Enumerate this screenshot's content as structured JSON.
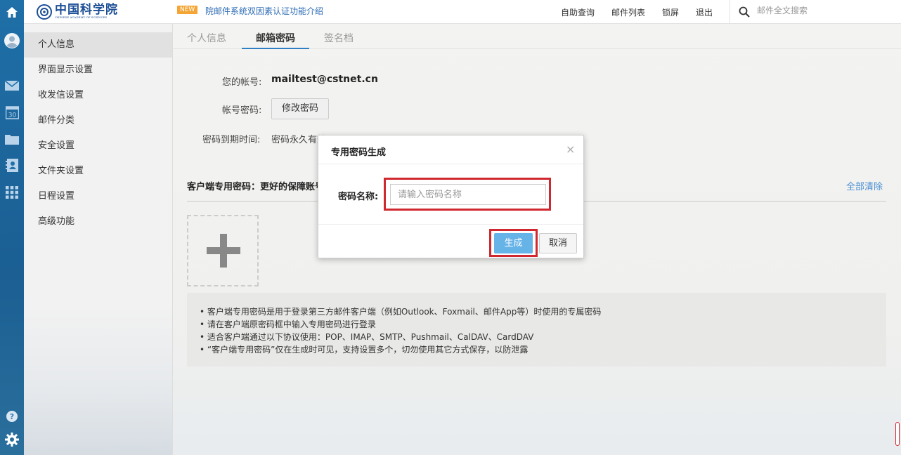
{
  "header": {
    "logo_text": "中国科学院",
    "logo_sub": "CHINESE ACADEMY OF SCIENCES",
    "badge": "NEW",
    "notice": "院邮件系统双因素认证功能介绍",
    "nav": [
      "自助查询",
      "邮件列表",
      "锁屏",
      "退出"
    ],
    "search_placeholder": "邮件全文搜索"
  },
  "rail": {
    "icons": [
      "home-icon",
      "avatar-icon",
      "mail-icon",
      "calendar-icon",
      "folder-icon",
      "contacts-icon",
      "apps-icon",
      "help-icon",
      "settings-icon"
    ],
    "calendar_day": "30"
  },
  "sidebar": {
    "items": [
      "个人信息",
      "界面显示设置",
      "收发信设置",
      "邮件分类",
      "安全设置",
      "文件夹设置",
      "日程设置",
      "高级功能"
    ],
    "active_index": 0
  },
  "tabs": [
    "个人信息",
    "邮箱密码",
    "签名档"
  ],
  "account": {
    "account_label": "您的帐号:",
    "account_value": "mailtest@cstnet.cn",
    "password_label": "帐号密码:",
    "change_password_button": "修改密码",
    "expiry_label": "密码到期时间:",
    "expiry_value": "密码永久有效"
  },
  "client_password": {
    "title": "客户端专用密码：更好的保障账号安全",
    "clear_all": "全部清除"
  },
  "tips": [
    "• 客户端专用密码是用于登录第三方邮件客户端（例如Outlook、Foxmail、邮件App等）时使用的专属密码",
    "• 请在客户端原密码框中输入专用密码进行登录",
    "• 适合客户端通过以下协议使用：POP、IMAP、SMTP、Pushmail、CalDAV、CardDAV",
    "• “客户端专用密码”仅在生成时可见，支持设置多个，切勿使用其它方式保存，以防泄露"
  ],
  "dialog": {
    "title": "专用密码生成",
    "close": "×",
    "name_label": "密码名称:",
    "name_placeholder": "请输入密码名称",
    "name_value": "",
    "generate_button": "生成",
    "cancel_button": "取消"
  },
  "colors": {
    "rail": "#1f6fa8",
    "accent": "#2f7fc7",
    "primary_button": "#66b3e8",
    "highlight": "#d0282e",
    "link": "#4b8fd3"
  }
}
